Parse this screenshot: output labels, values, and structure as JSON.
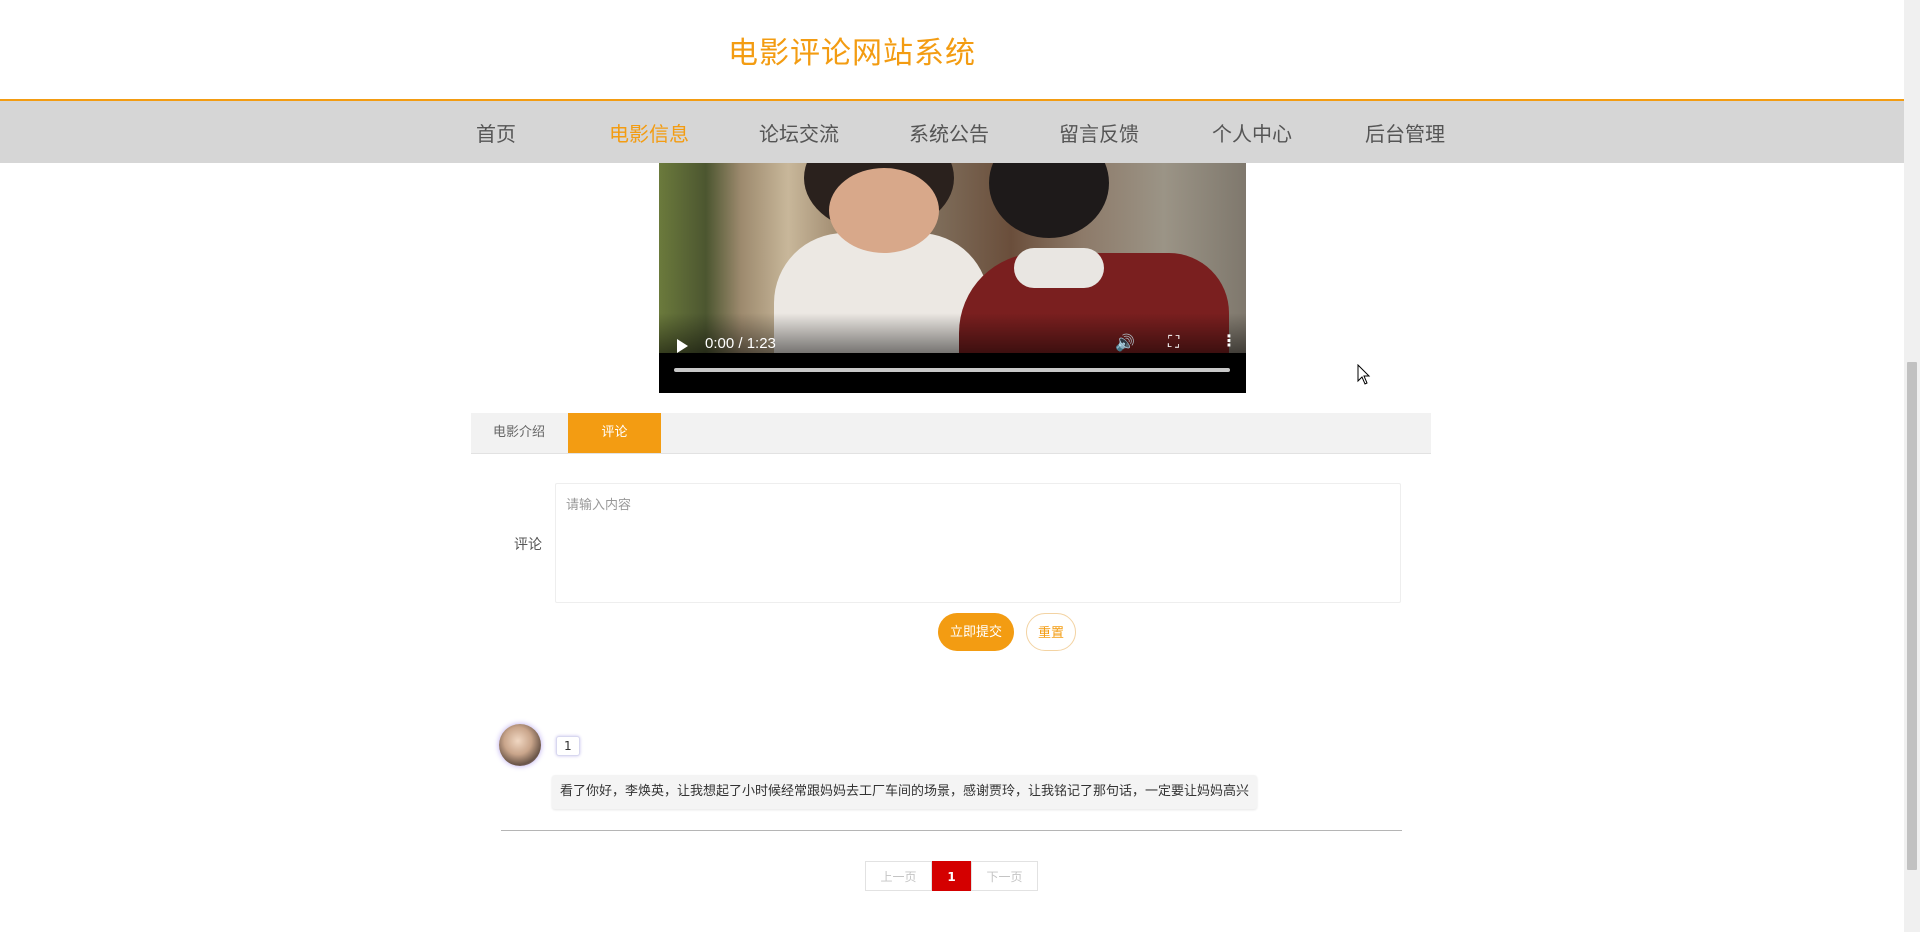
{
  "header": {
    "site_title": "电影评论网站系统"
  },
  "nav": {
    "items": [
      {
        "label": "首页"
      },
      {
        "label": "电影信息",
        "active": true
      },
      {
        "label": "论坛交流"
      },
      {
        "label": "系统公告"
      },
      {
        "label": "留言反馈"
      },
      {
        "label": "个人中心"
      },
      {
        "label": "后台管理"
      }
    ]
  },
  "video": {
    "time": "0:00 / 1:23",
    "progress": 0
  },
  "tabs": [
    {
      "label": "电影介绍"
    },
    {
      "label": "评论",
      "active": true
    }
  ],
  "form": {
    "label": "评论",
    "placeholder": "请输入内容",
    "value": "",
    "submit_label": "立即提交",
    "reset_label": "重置"
  },
  "comments": [
    {
      "username": "1",
      "content": "看了你好，李焕英，让我想起了小时候经常跟妈妈去工厂车间的场景，感谢贾玲，让我铭记了那句话，一定要让妈妈高兴"
    }
  ],
  "pagination": {
    "prev_label": "上一页",
    "current_page": "1",
    "next_label": "下一页"
  },
  "colors": {
    "accent": "#f39c12",
    "nav_bg": "#d6d6d6",
    "pager_active": "#d40000"
  }
}
